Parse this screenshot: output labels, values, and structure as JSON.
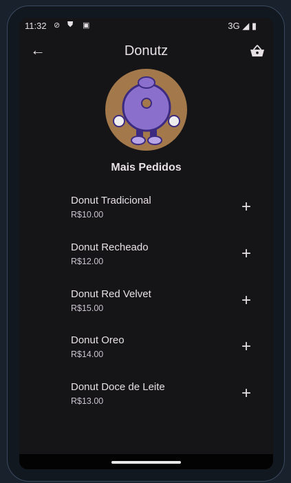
{
  "status": {
    "time": "11:32",
    "network": "3G"
  },
  "appbar": {
    "title": "Donutz"
  },
  "heading": "Mais Pedidos",
  "items": [
    {
      "name": "Donut Tradicional",
      "price": "R$10.00"
    },
    {
      "name": "Donut Recheado",
      "price": "R$12.00"
    },
    {
      "name": "Donut Red Velvet",
      "price": "R$15.00"
    },
    {
      "name": "Donut Oreo",
      "price": "R$14.00"
    },
    {
      "name": "Donut Doce de Leite",
      "price": "R$13.00"
    }
  ],
  "colors": {
    "background": "#151417",
    "logo_bg": "#a3784a",
    "donut": "#8a70cc"
  }
}
